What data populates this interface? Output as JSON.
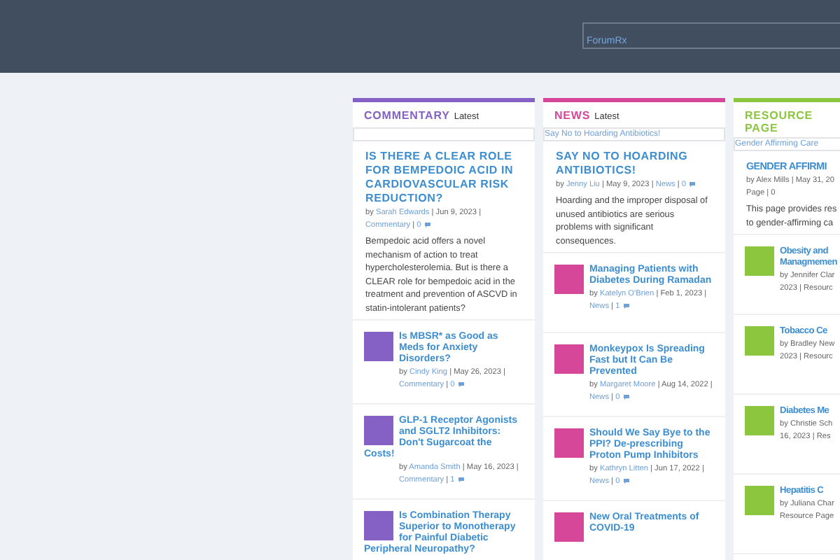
{
  "header": {
    "logo_link": "ForumRx"
  },
  "columns": [
    {
      "kind": "full",
      "heading": "COMMENTARY",
      "subheading": "Latest",
      "color": "#8561c5",
      "featured": {
        "title": "IS THERE A CLEAR ROLE FOR BEMPEDOIC ACID IN CARDIOVASCULAR RISK REDUCTION?",
        "meta": [
          {
            "kind": "plain",
            "text": "by "
          },
          {
            "kind": "link",
            "text": "Sarah Edwards"
          },
          {
            "kind": "plain",
            "text": " | Jun 9, 2023 | "
          },
          {
            "kind": "link",
            "text": "Commentary"
          },
          {
            "kind": "plain",
            "text": " | "
          },
          {
            "kind": "link",
            "text": "0"
          }
        ],
        "excerpt": "Bempedoic acid offers a novel mechanism of action to treat hypercholesterolemia. But is there a CLEAR role for bempedoic acid in the treatment and prevention of ASCVD in statin-intolerant patients?"
      },
      "items": [
        {
          "title": "Is MBSR* as Good as Meds for Anxiety Disorders?",
          "meta": [
            {
              "kind": "plain",
              "text": "by "
            },
            {
              "kind": "link",
              "text": "Cindy King"
            },
            {
              "kind": "plain",
              "text": " | May 26, 2023 | "
            },
            {
              "kind": "link",
              "text": "Commentary"
            },
            {
              "kind": "plain",
              "text": " | "
            },
            {
              "kind": "link",
              "text": "0"
            }
          ]
        },
        {
          "title": "GLP-1 Receptor Agonists and SGLT2 Inhibitors: Don't Sugarcoat the Costs!",
          "meta": [
            {
              "kind": "plain",
              "text": "by "
            },
            {
              "kind": "link",
              "text": "Amanda Smith"
            },
            {
              "kind": "plain",
              "text": " | May 16, 2023 | "
            },
            {
              "kind": "link",
              "text": "Commentary"
            },
            {
              "kind": "plain",
              "text": " | "
            },
            {
              "kind": "link",
              "text": "1"
            }
          ]
        },
        {
          "title": "Is Combination Therapy Superior to Monotherapy for Painful Diabetic Peripheral Neuropathy?"
        }
      ]
    },
    {
      "kind": "full",
      "heading": "NEWS",
      "subheading": "Latest",
      "color": "#d6479a",
      "ticker": "Say No to Hoarding Antibiotics!",
      "featured": {
        "title": "SAY NO TO HOARDING ANTIBIOTICS!",
        "meta": [
          {
            "kind": "plain",
            "text": "by "
          },
          {
            "kind": "link",
            "text": "Jenny Liu"
          },
          {
            "kind": "plain",
            "text": " | May 9, 2023 | "
          },
          {
            "kind": "link",
            "text": "News"
          },
          {
            "kind": "plain",
            "text": " | "
          },
          {
            "kind": "link",
            "text": "0"
          }
        ],
        "excerpt": "Hoarding and the improper disposal of unused antibiotics are serious problems with significant consequences."
      },
      "items": [
        {
          "title": "Managing Patients with Diabetes During Ramadan",
          "meta": [
            {
              "kind": "plain",
              "text": "by "
            },
            {
              "kind": "link",
              "text": "Katelyn O'Brien"
            },
            {
              "kind": "plain",
              "text": " | Feb 1, 2023 | "
            },
            {
              "kind": "link",
              "text": "News"
            },
            {
              "kind": "plain",
              "text": " | "
            },
            {
              "kind": "link",
              "text": "1"
            }
          ]
        },
        {
          "title": "Monkeypox Is Spreading Fast but It Can Be Prevented",
          "meta": [
            {
              "kind": "plain",
              "text": "by "
            },
            {
              "kind": "link",
              "text": "Margaret Moore"
            },
            {
              "kind": "plain",
              "text": " | Aug 14, 2022 | "
            },
            {
              "kind": "link",
              "text": "News"
            },
            {
              "kind": "plain",
              "text": " | "
            },
            {
              "kind": "link",
              "text": "0"
            }
          ]
        },
        {
          "title": "Should We Say Bye to the PPI? De-prescribing Proton Pump Inhibitors",
          "meta": [
            {
              "kind": "plain",
              "text": "by "
            },
            {
              "kind": "link",
              "text": "Kathryn Litten"
            },
            {
              "kind": "plain",
              "text": " | Jun 17, 2022 | "
            },
            {
              "kind": "link",
              "text": "News"
            },
            {
              "kind": "plain",
              "text": " | "
            },
            {
              "kind": "link",
              "text": "0"
            }
          ]
        },
        {
          "title": "New Oral Treatments of COVID-19"
        }
      ]
    },
    {
      "kind": "clipped",
      "heading": "RESOURCE PAGE",
      "color": "#8cc63f",
      "ticker": "Gender Affirming Care",
      "featured": {
        "title": "GENDER AFFIRMI",
        "meta_lines": [
          "by Alex Mills | May 31, 20",
          "Page | 0"
        ],
        "excerpt_lines": [
          "This page provides res",
          "to gender-affirming ca"
        ]
      },
      "items": [
        {
          "title_lines": [
            "Obesity and",
            "Managmemen"
          ],
          "meta_lines": [
            "by Jennifer Clar",
            "2023 | Resourc"
          ]
        },
        {
          "title_lines": [
            "Tobacco Ce"
          ],
          "meta_lines": [
            "by Bradley New",
            "2023 | Resourc"
          ]
        },
        {
          "title_lines": [
            "Diabetes Me"
          ],
          "meta_lines": [
            "by Christie Sch",
            "16, 2023 | Res"
          ]
        },
        {
          "title_lines": [
            "Hepatitis C"
          ],
          "meta_lines": [
            "by Juliana Char",
            "Resource Page"
          ]
        }
      ]
    }
  ]
}
